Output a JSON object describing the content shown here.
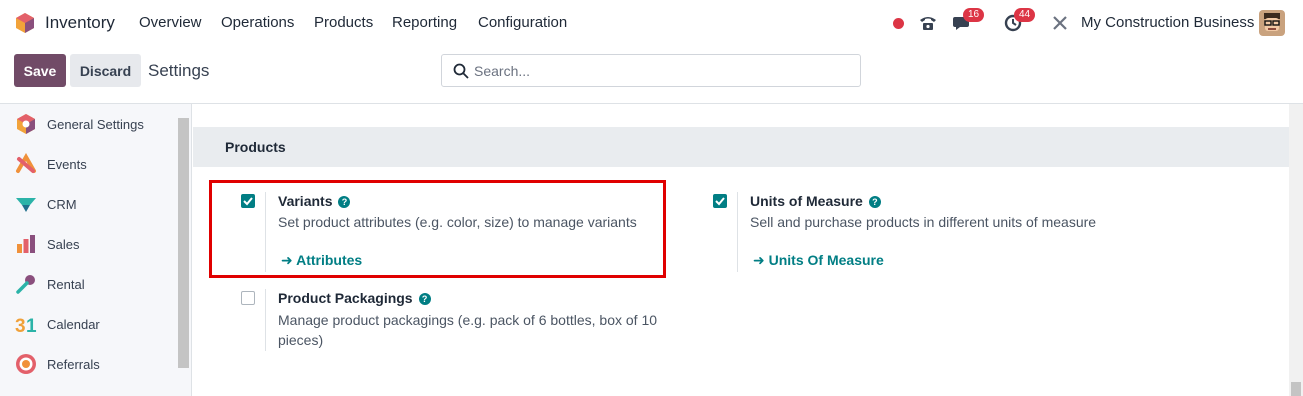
{
  "navbar": {
    "app_name": "Inventory",
    "menus": [
      "Overview",
      "Operations",
      "Products",
      "Reporting",
      "Configuration"
    ],
    "messages_badge": "16",
    "activities_badge": "44",
    "company": "My Construction Business"
  },
  "control": {
    "save_label": "Save",
    "discard_label": "Discard",
    "page_title": "Settings",
    "search_placeholder": "Search..."
  },
  "sidebar": {
    "items": [
      {
        "label": "General Settings",
        "icon": "general-settings-icon"
      },
      {
        "label": "Events",
        "icon": "events-icon"
      },
      {
        "label": "CRM",
        "icon": "crm-icon"
      },
      {
        "label": "Sales",
        "icon": "sales-icon"
      },
      {
        "label": "Rental",
        "icon": "rental-icon"
      },
      {
        "label": "Calendar",
        "icon": "calendar-icon"
      },
      {
        "label": "Referrals",
        "icon": "referrals-icon"
      }
    ]
  },
  "section": {
    "title": "Products",
    "settings": [
      {
        "title": "Variants",
        "desc": "Set product attributes (e.g. color, size) to manage variants",
        "link": "Attributes",
        "checked": true
      },
      {
        "title": "Units of Measure",
        "desc": "Sell and purchase products in different units of measure",
        "link": "Units Of Measure",
        "checked": true
      },
      {
        "title": "Product Packagings",
        "desc_line1": "Manage product packagings (e.g. pack of 6 bottles, box of 10",
        "desc_line2": "pieces)",
        "checked": false
      }
    ]
  },
  "colors": {
    "brand": "#714b67",
    "accent": "#017e84",
    "highlight": "#e00000",
    "badge": "#dc3545"
  }
}
